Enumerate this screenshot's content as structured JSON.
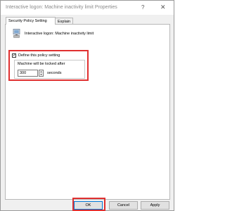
{
  "window": {
    "title": "Interactive logon: Machine inactivity limit Properties",
    "help_symbol": "?",
    "close_symbol": "✕"
  },
  "tabs": [
    {
      "label": "Security Policy Setting",
      "active": true
    },
    {
      "label": "Explain",
      "active": false
    }
  ],
  "policy": {
    "icon": "policy-computer-icon",
    "name": "Interactive logon: Machine inactivity limit"
  },
  "define": {
    "label": "Define this policy setting",
    "checked": true,
    "check_mark": "✓"
  },
  "lock": {
    "label": "Machine will be locked after",
    "value": "300",
    "unit": "seconds",
    "spin_up": "▲",
    "spin_down": "▼"
  },
  "buttons": {
    "ok": "OK",
    "cancel": "Cancel",
    "apply": "Apply"
  },
  "colors": {
    "highlight": "#e03030",
    "default_button_border": "#0078d7"
  }
}
